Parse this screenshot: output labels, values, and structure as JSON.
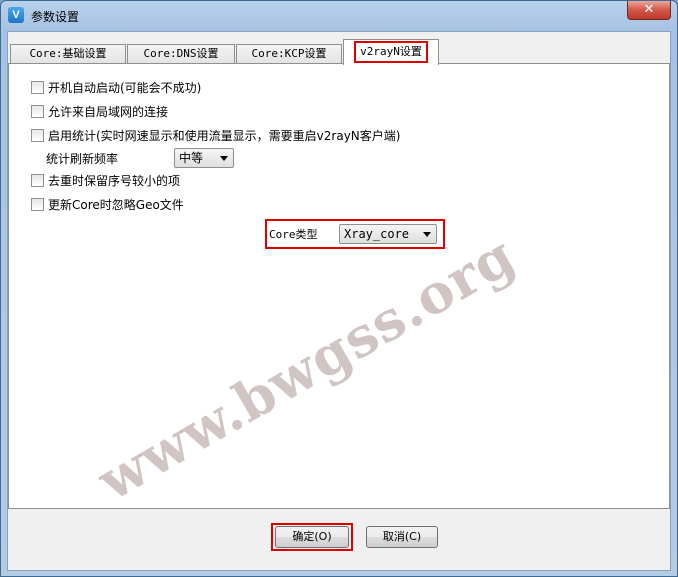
{
  "window": {
    "title": "参数设置",
    "app_icon": "V",
    "close_glyph": "✕"
  },
  "tabs": [
    {
      "label": "Core:基础设置",
      "active": false
    },
    {
      "label": "Core:DNS设置",
      "active": false
    },
    {
      "label": "Core:KCP设置",
      "active": false
    },
    {
      "label": "v2rayN设置",
      "active": true
    }
  ],
  "settings": {
    "autostart_label": "开机自动启动(可能会不成功)",
    "allow_lan_label": "允许来自局域网的连接",
    "enable_stats_label": "启用统计(实时网速显示和使用流量显示，需要重启v2rayN客户端)",
    "stats_freq_label": "统计刷新频率",
    "stats_freq_value": "中等",
    "keep_smaller_label": "去重时保留序号较小的项",
    "ignore_geo_label": "更新Core时忽略Geo文件",
    "core_type_label": "Core类型",
    "core_type_value": "Xray_core"
  },
  "buttons": {
    "ok_label": "确定(O)",
    "cancel_label": "取消(C)"
  },
  "watermark": "www.bwgss.org",
  "colors": {
    "highlight": "#e00000",
    "close_button": "#c0392b"
  }
}
